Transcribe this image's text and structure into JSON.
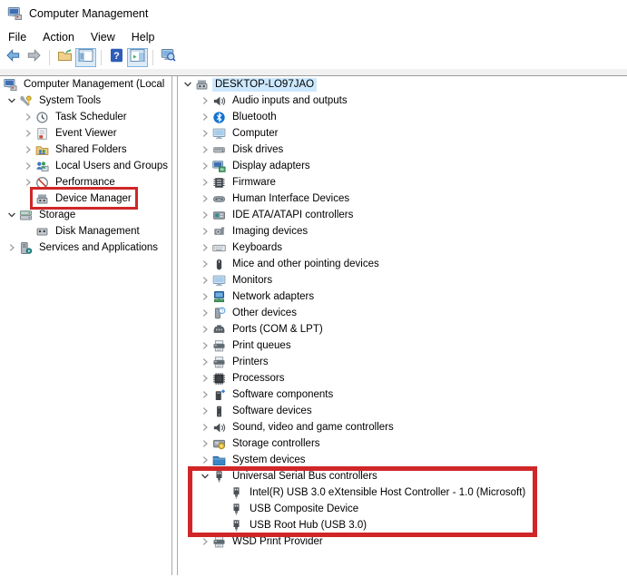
{
  "window": {
    "title": "Computer Management",
    "icon": "computer-management-icon"
  },
  "menu": {
    "items": [
      "File",
      "Action",
      "View",
      "Help"
    ]
  },
  "toolbar": {
    "buttons": [
      {
        "name": "back-button",
        "icon": "back-arrow-icon"
      },
      {
        "name": "forward-button",
        "icon": "forward-arrow-icon"
      },
      {
        "separator": true
      },
      {
        "name": "up-level-button",
        "icon": "up-folder-icon"
      },
      {
        "name": "show-console-tree-button",
        "icon": "console-tree-toggle-icon",
        "active": true
      },
      {
        "separator": true
      },
      {
        "name": "help-button",
        "icon": "help-icon"
      },
      {
        "name": "show-action-pane-button",
        "icon": "action-pane-toggle-icon",
        "active": true
      },
      {
        "separator": true
      },
      {
        "name": "monitor-search-button",
        "icon": "monitor-search-icon"
      }
    ]
  },
  "left_pane": {
    "items": [
      {
        "label": "Computer Management (Local",
        "level": 0,
        "chevron": "skip",
        "icon": "computer-management-icon"
      },
      {
        "label": "System Tools",
        "level": 0,
        "chevron": "expanded",
        "icon": "system-tools-icon"
      },
      {
        "label": "Task Scheduler",
        "level": 1,
        "chevron": "collapsed",
        "icon": "task-scheduler-icon"
      },
      {
        "label": "Event Viewer",
        "level": 1,
        "chevron": "collapsed",
        "icon": "event-viewer-icon"
      },
      {
        "label": "Shared Folders",
        "level": 1,
        "chevron": "collapsed",
        "icon": "shared-folders-icon"
      },
      {
        "label": "Local Users and Groups",
        "level": 1,
        "chevron": "collapsed",
        "icon": "local-users-icon"
      },
      {
        "label": "Performance",
        "level": 1,
        "chevron": "collapsed",
        "icon": "performance-icon"
      },
      {
        "label": "Device Manager",
        "level": 1,
        "chevron": "none",
        "icon": "device-manager-icon"
      },
      {
        "label": "Storage",
        "level": 0,
        "chevron": "expanded",
        "icon": "storage-icon"
      },
      {
        "label": "Disk Management",
        "level": 1,
        "chevron": "none",
        "icon": "disk-management-icon"
      },
      {
        "label": "Services and Applications",
        "level": 0,
        "chevron": "collapsed",
        "icon": "services-icon"
      }
    ]
  },
  "right_pane": {
    "items": [
      {
        "label": "DESKTOP-LO97JAO",
        "level": 0,
        "chevron": "expanded",
        "icon": "computer-node-icon",
        "selected": true
      },
      {
        "label": "Audio inputs and outputs",
        "level": 1,
        "chevron": "collapsed",
        "icon": "audio-icon"
      },
      {
        "label": "Bluetooth",
        "level": 1,
        "chevron": "collapsed",
        "icon": "bluetooth-icon"
      },
      {
        "label": "Computer",
        "level": 1,
        "chevron": "collapsed",
        "icon": "computer-icon"
      },
      {
        "label": "Disk drives",
        "level": 1,
        "chevron": "collapsed",
        "icon": "disk-drive-icon"
      },
      {
        "label": "Display adapters",
        "level": 1,
        "chevron": "collapsed",
        "icon": "display-adapter-icon"
      },
      {
        "label": "Firmware",
        "level": 1,
        "chevron": "collapsed",
        "icon": "firmware-icon"
      },
      {
        "label": "Human Interface Devices",
        "level": 1,
        "chevron": "collapsed",
        "icon": "hid-icon"
      },
      {
        "label": "IDE ATA/ATAPI controllers",
        "level": 1,
        "chevron": "collapsed",
        "icon": "ide-icon"
      },
      {
        "label": "Imaging devices",
        "level": 1,
        "chevron": "collapsed",
        "icon": "imaging-icon"
      },
      {
        "label": "Keyboards",
        "level": 1,
        "chevron": "collapsed",
        "icon": "keyboard-icon"
      },
      {
        "label": "Mice and other pointing devices",
        "level": 1,
        "chevron": "collapsed",
        "icon": "mouse-icon"
      },
      {
        "label": "Monitors",
        "level": 1,
        "chevron": "collapsed",
        "icon": "monitor-icon"
      },
      {
        "label": "Network adapters",
        "level": 1,
        "chevron": "collapsed",
        "icon": "network-icon"
      },
      {
        "label": "Other devices",
        "level": 1,
        "chevron": "collapsed",
        "icon": "other-devices-icon"
      },
      {
        "label": "Ports (COM & LPT)",
        "level": 1,
        "chevron": "collapsed",
        "icon": "ports-icon"
      },
      {
        "label": "Print queues",
        "level": 1,
        "chevron": "collapsed",
        "icon": "print-queue-icon"
      },
      {
        "label": "Printers",
        "level": 1,
        "chevron": "collapsed",
        "icon": "printer-icon"
      },
      {
        "label": "Processors",
        "level": 1,
        "chevron": "collapsed",
        "icon": "processor-icon"
      },
      {
        "label": "Software components",
        "level": 1,
        "chevron": "collapsed",
        "icon": "software-component-icon"
      },
      {
        "label": "Software devices",
        "level": 1,
        "chevron": "collapsed",
        "icon": "software-device-icon"
      },
      {
        "label": "Sound, video and game controllers",
        "level": 1,
        "chevron": "collapsed",
        "icon": "sound-icon"
      },
      {
        "label": "Storage controllers",
        "level": 1,
        "chevron": "collapsed",
        "icon": "storage-controller-icon"
      },
      {
        "label": "System devices",
        "level": 1,
        "chevron": "collapsed",
        "icon": "system-devices-icon"
      },
      {
        "label": "Universal Serial Bus controllers",
        "level": 1,
        "chevron": "expanded",
        "icon": "usb-icon"
      },
      {
        "label": "Intel(R) USB 3.0 eXtensible Host Controller - 1.0 (Microsoft)",
        "level": 2,
        "chevron": "none",
        "icon": "usb-icon"
      },
      {
        "label": "USB Composite Device",
        "level": 2,
        "chevron": "none",
        "icon": "usb-icon"
      },
      {
        "label": "USB Root Hub (USB 3.0)",
        "level": 2,
        "chevron": "none",
        "icon": "usb-icon"
      },
      {
        "label": "WSD Print Provider",
        "level": 1,
        "chevron": "collapsed",
        "icon": "printer-icon"
      }
    ]
  },
  "annotations": {
    "highlight_color": "#d02628",
    "boxes": [
      "device-manager-annotation-box",
      "usb-controllers-annotation-box"
    ]
  },
  "colors": {
    "annotation_red": "#d02628",
    "selection_blue": "#cce8ff",
    "toolbar_active_bg": "#dcebf7",
    "toolbar_active_border": "#7eb4e2"
  }
}
